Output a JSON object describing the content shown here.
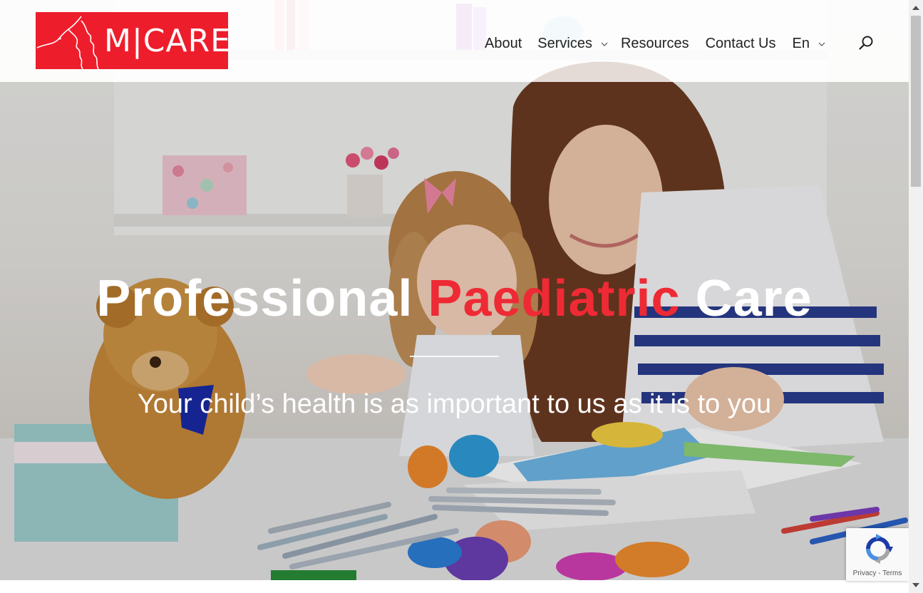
{
  "header": {
    "logo_text": "M|CARE",
    "nav": [
      {
        "label": "About",
        "has_dropdown": false
      },
      {
        "label": "Services",
        "has_dropdown": true
      },
      {
        "label": "Resources",
        "has_dropdown": false
      },
      {
        "label": "Contact Us",
        "has_dropdown": false
      },
      {
        "label": "En",
        "has_dropdown": true
      }
    ],
    "search_icon": "search-icon"
  },
  "hero": {
    "title_part1": "Professional ",
    "title_accent": "Paediatric",
    "title_part2": " Care",
    "subtitle": "Your child’s health is as important to us as it is to you"
  },
  "recaptcha": {
    "privacy": "Privacy",
    "separator": " - ",
    "terms": "Terms"
  },
  "colors": {
    "brand_red": "#ee1d2c",
    "accent_red": "#ee2a35",
    "nav_text": "#222222"
  }
}
